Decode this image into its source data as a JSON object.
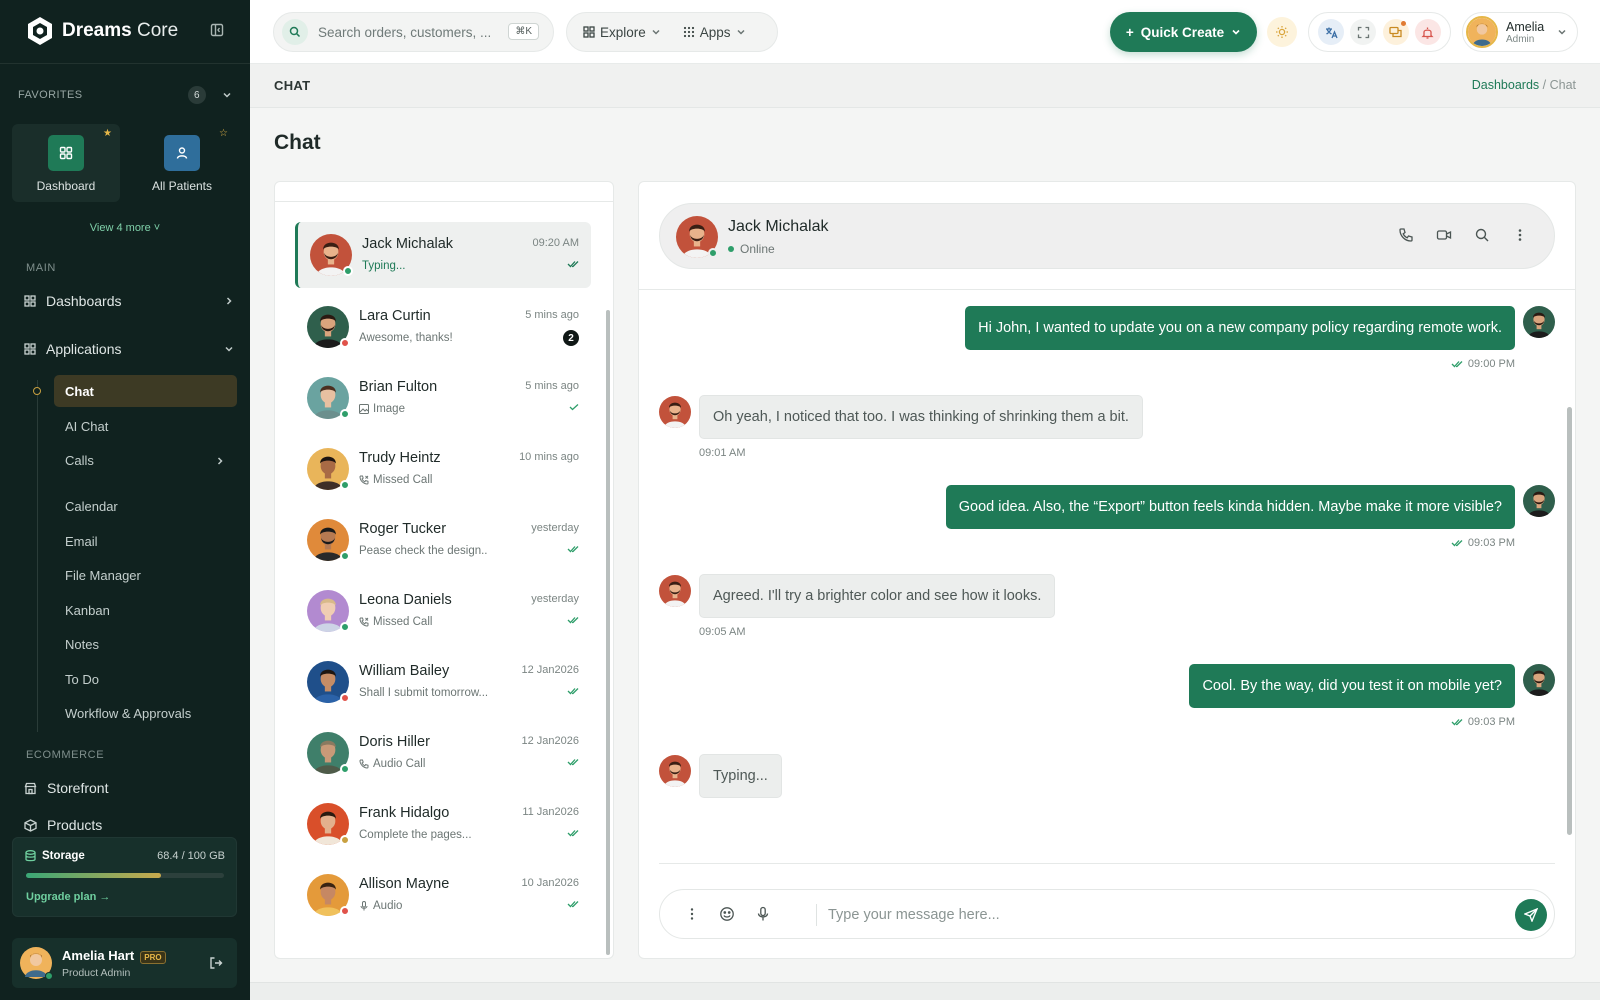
{
  "app": {
    "name_part1": "Dreams",
    "name_part2": "Core"
  },
  "sidebar": {
    "favorites_label": "FAVORITES",
    "favorites_count": "6",
    "fav_cards": [
      {
        "label": "Dashboard"
      },
      {
        "label": "All Patients"
      }
    ],
    "view_more": "View 4 more",
    "section_main": "MAIN",
    "dashboards": "Dashboards",
    "applications": "Applications",
    "sub_items": [
      "Chat",
      "AI Chat",
      "Calls",
      "Calendar",
      "Email",
      "File Manager",
      "Kanban",
      "Notes",
      "To Do",
      "Workflow & Approvals"
    ],
    "section_ecommerce": "ECOMMERCE",
    "storefront": "Storefront",
    "products": "Products",
    "storage": {
      "label": "Storage",
      "value": "68.4 / 100 GB",
      "used_fraction": 0.684,
      "upgrade": "Upgrade plan"
    },
    "user": {
      "name": "Amelia Hart",
      "badge": "PRO",
      "role": "Product Admin"
    }
  },
  "topbar": {
    "search_placeholder": "Search orders, customers, ...",
    "search_kbd": "⌘K",
    "explore": "Explore",
    "apps": "Apps",
    "quick_create": "Quick Create",
    "user_name": "Amelia",
    "user_role": "Admin"
  },
  "page": {
    "crumb_title": "CHAT",
    "breadcrumb": [
      "Dashboards",
      "Chat"
    ],
    "title": "Chat"
  },
  "contacts": [
    {
      "name": "Jack Michalak",
      "preview": "Typing...",
      "time": "09:20 AM",
      "status": "online",
      "tick": "double"
    },
    {
      "name": "Lara Curtin",
      "preview": "Awesome, thanks!",
      "time": "5 mins ago",
      "status": "busy",
      "unread": "2"
    },
    {
      "name": "Brian Fulton",
      "preview": "Image",
      "time": "5 mins ago",
      "status": "online",
      "tick": "single",
      "icon": "image-icon"
    },
    {
      "name": "Trudy Heintz",
      "preview": "Missed Call",
      "time": "10 mins ago",
      "status": "online",
      "icon": "phone-missed-icon"
    },
    {
      "name": "Roger Tucker",
      "preview": "Pease check the design..",
      "time": "yesterday",
      "status": "online",
      "tick": "double"
    },
    {
      "name": "Leona Daniels",
      "preview": "Missed Call",
      "time": "yesterday",
      "status": "online",
      "tick": "double",
      "icon": "phone-missed-icon"
    },
    {
      "name": "William Bailey",
      "preview": "Shall I submit tomorrow...",
      "time": "12 Jan2026",
      "status": "busy",
      "tick": "double"
    },
    {
      "name": "Doris Hiller",
      "preview": "Audio Call",
      "time": "12 Jan2026",
      "status": "online",
      "tick": "double",
      "icon": "phone-icon"
    },
    {
      "name": "Frank Hidalgo",
      "preview": "Complete the pages...",
      "time": "11 Jan2026",
      "status": "away",
      "tick": "double"
    },
    {
      "name": "Allison Mayne",
      "preview": "Audio",
      "time": "10 Jan2026",
      "status": "busy",
      "tick": "double",
      "icon": "mic-icon"
    }
  ],
  "chat": {
    "name": "Jack Michalak",
    "status": "Online",
    "messages": [
      {
        "dir": "out",
        "text": "Hi John, I wanted to update you on a new company policy regarding remote work.",
        "time": "09:00 PM"
      },
      {
        "dir": "in",
        "text": "Oh yeah, I noticed that too. I was thinking of shrinking them a bit.",
        "time": "09:01 AM"
      },
      {
        "dir": "out",
        "text": "Good idea. Also, the “Export” button feels kinda hidden. Maybe make it more visible?",
        "time": "09:03 PM"
      },
      {
        "dir": "in",
        "text": "Agreed. I'll try a brighter color and see how it looks.",
        "time": "09:05 AM"
      },
      {
        "dir": "out",
        "text": "Cool. By the way, did you test it on mobile yet?",
        "time": "09:03 PM"
      },
      {
        "dir": "in",
        "text": "Typing..."
      }
    ],
    "composer_placeholder": "Type your message here..."
  },
  "colors": {
    "brand": "#1f7a57",
    "sidebar_bg": "#10221f",
    "online": "#2e9e6a",
    "busy": "#e0524a",
    "away": "#c8a040"
  }
}
